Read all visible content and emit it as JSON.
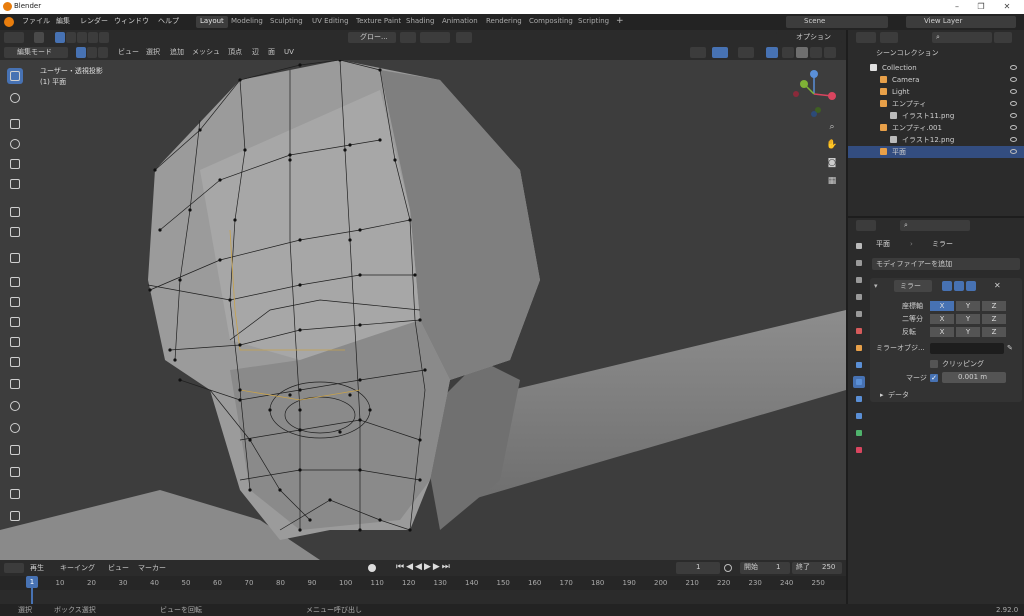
{
  "app": {
    "title": "Blender",
    "version": "2.92.0"
  },
  "menu": [
    "ファイル",
    "編集",
    "レンダー",
    "ウィンドウ",
    "ヘルプ"
  ],
  "workspaces": [
    "Layout",
    "Modeling",
    "Sculpting",
    "UV Editing",
    "Texture Paint",
    "Shading",
    "Animation",
    "Rendering",
    "Compositing",
    "Scripting"
  ],
  "active_workspace": "Layout",
  "scene": "Scene",
  "view_layer": "View Layer",
  "viewport": {
    "mode": "編集モード",
    "menus": [
      "ビュー",
      "選択",
      "追加",
      "メッシュ",
      "頂点",
      "辺",
      "面",
      "UV"
    ],
    "transform": "グロー...",
    "options": "オプション",
    "info_line1": "ユーザー・透視投影",
    "info_line2": "(1) 平面"
  },
  "timeline": {
    "menus": [
      "再生",
      "キーイング",
      "ビュー",
      "マーカー"
    ],
    "current_frame": "1",
    "start_label": "開始",
    "start": "1",
    "end_label": "終了",
    "end": "250",
    "ticks": [
      "1",
      "10",
      "20",
      "30",
      "40",
      "50",
      "60",
      "70",
      "80",
      "90",
      "100",
      "110",
      "120",
      "130",
      "140",
      "150",
      "160",
      "170",
      "180",
      "190",
      "200",
      "210",
      "220",
      "230",
      "240",
      "250"
    ]
  },
  "statusbar": {
    "items": [
      "選択",
      "ボックス選択",
      "ビューを回転",
      "メニュー呼び出し"
    ],
    "version": "2.92.0"
  },
  "outliner": {
    "root": "シーンコレクション",
    "rows": [
      {
        "label": "Collection",
        "icon": "collection-icon",
        "indent": 1
      },
      {
        "label": "Camera",
        "icon": "camera-icon",
        "indent": 2
      },
      {
        "label": "Light",
        "icon": "light-icon",
        "indent": 2
      },
      {
        "label": "エンプティ",
        "icon": "empty-icon",
        "indent": 2
      },
      {
        "label": "イラスト11.png",
        "icon": "image-icon",
        "indent": 3
      },
      {
        "label": "エンプティ.001",
        "icon": "empty-icon",
        "indent": 2
      },
      {
        "label": "イラスト12.png",
        "icon": "image-icon",
        "indent": 3
      },
      {
        "label": "平面",
        "icon": "mesh-icon",
        "indent": 2,
        "selected": true
      }
    ]
  },
  "properties": {
    "object": "平面",
    "modifier_tab": "ミラー",
    "add_modifier": "モディファイアーを追加",
    "modifier_name": "ミラー",
    "axis_label": "座標軸",
    "bisect_label": "二等分",
    "flip_label": "反転",
    "axes": [
      "X",
      "Y",
      "Z"
    ],
    "mirror_object": "ミラーオブジ...",
    "clipping": "クリッピング",
    "merge": "マージ",
    "merge_value": "0.001 m",
    "data": "データ"
  },
  "colors": {
    "accent": "#4772b3",
    "viewport_bg": "#3d3d3d",
    "mesh": "#a6a6a6",
    "panel": "#2b2b2b"
  }
}
